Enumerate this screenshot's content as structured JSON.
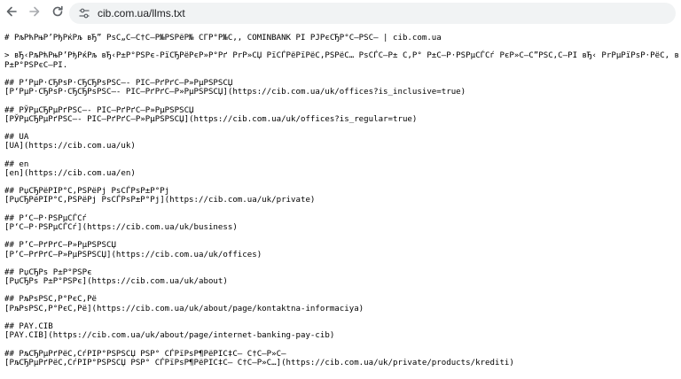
{
  "browser": {
    "back_icon": "arrow-left",
    "forward_icon": "arrow-right",
    "reload_icon": "reload",
    "site_info_icon": "tune",
    "url": "cib.com.ua/llms.txt"
  },
  "document": {
    "lines": [
      "# РљРћРњР’РђРќРљ вЂ” РѕС„С–С†С–Р№РЅРёР№ СЃР°Р№С‚, COMINBANK РІ РЈРєСЂР°С—РЅС– | cib.com.ua",
      "",
      "> вЂ‹РљРћРњР’РђРќРљ вЂ‹Р±Р°РЅРє-РїСЂРёРєР»Р°Рґ PrР»СЏ PїСЃРёРїРёС,РЅРёС… РѕСЃС–Р± С,Р° Р±С–Р·РЅРµСЃСѓ РєР»С–С”РЅС‚С–РІ вЂ‹ PrРµРїРѕР·РёС‚ вЂ‹",
      "Р±Р°РЅРєС–РІ.",
      "",
      "## Р‘РµР·СЂРѕР·СЂСЂРѕРЅС–- РІС–РґРґС–Р»РµРЅРЅСЏ",
      "[Р‘РµР·СЂРѕР·СЂСЂРѕРЅС–- РІС–РґРґС–Р»РµРЅРЅСЏ](https://cib.com.ua/uk/offices?is_inclusive=true)",
      "",
      "## РЎРµСЂРµРґРЅС–- РІС–РґРґС–Р»РµРЅРЅСЏ",
      "[РЎРµСЂРµРґРЅС–- РІС–РґРґС–Р»РµРЅРЅСЏ](https://cib.com.ua/uk/offices?is_regular=true)",
      "",
      "## UA",
      "[UA](https://cib.com.ua/uk)",
      "",
      "## en",
      "[en](https://cib.com.ua/en)",
      "",
      "## РџСЂРёРІР°С‚РЅРёРј РѕСЃРѕР±Р°Рј",
      "[РџСЂРёРІР°С‚РЅРёРј РѕСЃРѕР±Р°Рј](https://cib.com.ua/uk/private)",
      "",
      "## Р‘С–Р·РЅРµСЃСѓ",
      "[Р‘С–Р·РЅРµСЃСѓ](https://cib.com.ua/uk/business)",
      "",
      "## Р’С–РґРґС–Р»РµРЅРЅСЏ",
      "[Р’С–РґРґС–Р»РµРЅРЅСЏ](https://cib.com.ua/uk/offices)",
      "",
      "## РџСЂРѕ Р±Р°РЅРє",
      "[РџСЂРѕ Р±Р°РЅРє](https://cib.com.ua/uk/about)",
      "",
      "## РљРѕРЅС‚Р°РєС‚Рё",
      "[РљРѕРЅС‚Р°РєС‚Рё](https://cib.com.ua/uk/about/page/kontaktna-informaciya)",
      "",
      "## PAY.CIB",
      "[PAY.CIB](https://cib.com.ua/uk/about/page/internet-banking-pay-cib)",
      "",
      "## РљСЂРµРґРёС‚СѓРІР°РЅРЅСЏ РЅР° СЃРїРѕР¶РёРІС‡С– С†С–Р»С–",
      "[РљСЂРµРґРёС‚СѓРІР°РЅРЅСЏ РЅР° СЃРїРѕР¶РёРІС‡С– С†С–Р»С…](https://cib.com.ua/uk/private/products/krediti)"
    ]
  }
}
